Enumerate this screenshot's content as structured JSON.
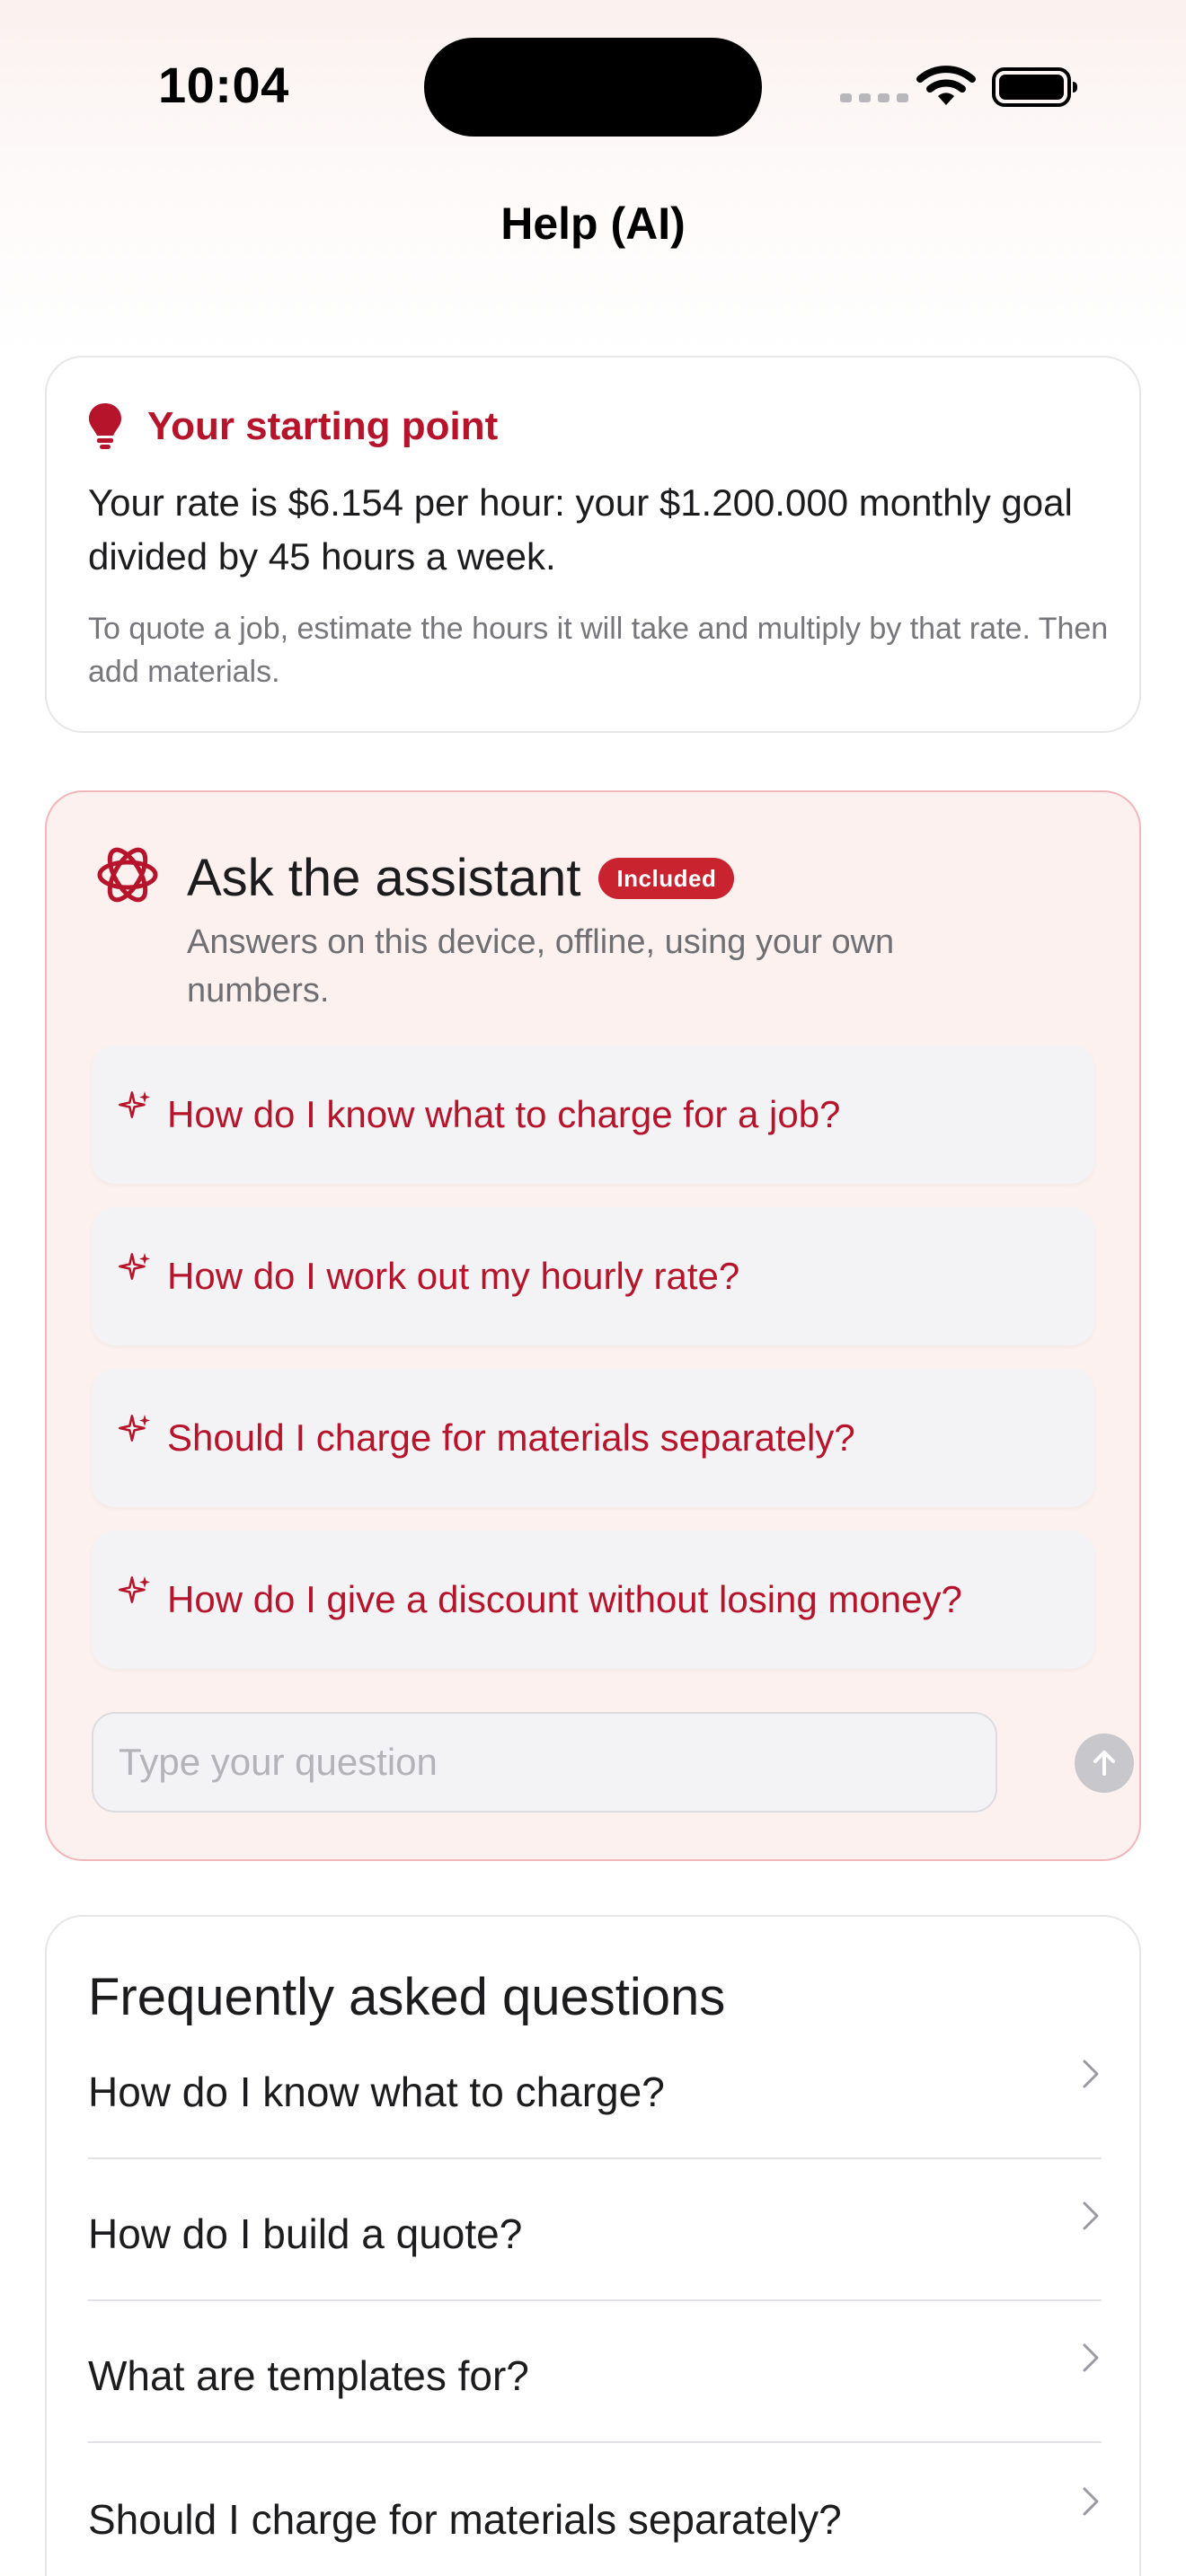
{
  "status_bar": {
    "time": "10:04"
  },
  "header": {
    "title": "Help (AI)"
  },
  "starting_point": {
    "icon": "lightbulb-icon",
    "title": "Your starting point",
    "body": "Your rate is $6.154 per hour: your $1.200.000 monthly goal divided by 45 hours a week.",
    "note": "To quote a job, estimate the hours it will take and multiply by that rate. Then add materials."
  },
  "assistant": {
    "icon": "atom-icon",
    "title": "Ask the assistant",
    "badge": "Included",
    "subtitle": "Answers on this device, offline, using your own numbers.",
    "suggestions": [
      "How do I know what to charge for a job?",
      "How do I work out my hourly rate?",
      "Should I charge for materials separately?",
      "How do I give a discount without losing money?"
    ],
    "input": {
      "placeholder": "Type your question",
      "value": ""
    },
    "send_icon": "arrow-up-icon"
  },
  "faq": {
    "title": "Frequently asked questions",
    "items": [
      "How do I know what to charge?",
      "How do I build a quote?",
      "What are templates for?",
      "Should I charge for materials separately?"
    ]
  },
  "colors": {
    "accent": "#b5142b",
    "badge": "#c8232f",
    "assistant_bg": "#fdf1f0",
    "assistant_border": "#f2b5b9"
  }
}
